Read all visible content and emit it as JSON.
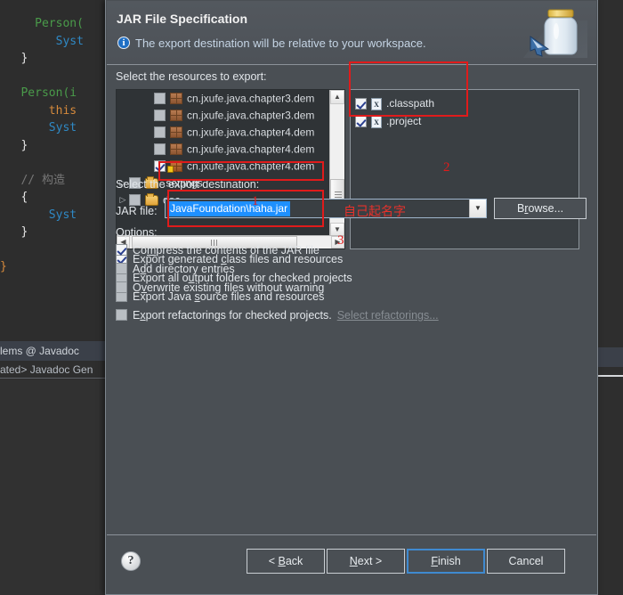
{
  "background": {
    "code_lines": [
      {
        "indent": 5,
        "segments": [
          {
            "t": "Person(",
            "c": "green"
          }
        ]
      },
      {
        "indent": 8,
        "segments": [
          {
            "t": "Syst",
            "c": "blue"
          }
        ]
      },
      {
        "indent": 3,
        "segments": [
          {
            "t": "}",
            "c": "white"
          }
        ]
      },
      {
        "indent": 0,
        "segments": []
      },
      {
        "indent": 3,
        "segments": [
          {
            "t": "Person(i",
            "c": "green"
          }
        ]
      },
      {
        "indent": 7,
        "segments": [
          {
            "t": "this",
            "c": "orange"
          }
        ]
      },
      {
        "indent": 7,
        "segments": [
          {
            "t": "Syst",
            "c": "blue"
          }
        ]
      },
      {
        "indent": 3,
        "segments": [
          {
            "t": "}",
            "c": "white"
          }
        ]
      },
      {
        "indent": 0,
        "segments": []
      },
      {
        "indent": 3,
        "segments": [
          {
            "t": "// 构造",
            "c": "gray"
          }
        ]
      },
      {
        "indent": 3,
        "segments": [
          {
            "t": "{",
            "c": "white"
          }
        ]
      },
      {
        "indent": 7,
        "segments": [
          {
            "t": "Syst",
            "c": "blue"
          }
        ]
      },
      {
        "indent": 3,
        "segments": [
          {
            "t": "}",
            "c": "white"
          }
        ]
      },
      {
        "indent": 0,
        "segments": []
      },
      {
        "indent": 0,
        "segments": [
          {
            "t": "}",
            "c": "orange"
          }
        ]
      }
    ],
    "tabs_text": "lems  @ Javadoc",
    "javadoc_status": "ated> Javadoc Gen"
  },
  "dialog": {
    "title": "JAR File Specification",
    "subtitle": "The export destination will be relative to your workspace.",
    "info_icon": "i",
    "jar_icon_name": "jar-file-icon"
  },
  "resources": {
    "label": "Select the resources to export:",
    "tree_items": [
      {
        "twisty": "",
        "checked": false,
        "icon": "package-icon",
        "label": "cn.jxufe.java.chapter3.dem"
      },
      {
        "twisty": "",
        "checked": false,
        "icon": "package-icon",
        "label": "cn.jxufe.java.chapter3.dem"
      },
      {
        "twisty": "",
        "checked": false,
        "icon": "package-icon",
        "label": "cn.jxufe.java.chapter4.dem"
      },
      {
        "twisty": "",
        "checked": false,
        "icon": "package-icon",
        "label": "cn.jxufe.java.chapter4.dem"
      },
      {
        "twisty": "",
        "checked": true,
        "icon": "package-locked-icon",
        "label": "cn.jxufe.java.chapter4.dem"
      },
      {
        "twisty": "▷",
        "checked": false,
        "icon": "folder-icon",
        "label": ".settings"
      },
      {
        "twisty": "▷",
        "checked": false,
        "icon": "folder-icon",
        "label": "doc"
      }
    ],
    "files": [
      {
        "checked": true,
        "icon": "xml-file-icon",
        "badge": "X",
        "label": ".classpath"
      },
      {
        "checked": true,
        "icon": "xml-file-icon",
        "badge": "X",
        "label": ".project"
      }
    ]
  },
  "export_options": [
    {
      "checked": true,
      "pre": "Export generated ",
      "mn": "c",
      "post": "lass files and resources"
    },
    {
      "checked": false,
      "pre": "Export all o",
      "mn": "u",
      "post": "tput folders for checked projects"
    },
    {
      "checked": false,
      "pre": "Export Java ",
      "mn": "s",
      "post": "ource files and resources"
    },
    {
      "checked": false,
      "pre": "E",
      "mn": "x",
      "post": "port refactorings for checked projects.",
      "link": "Select refactorings..."
    }
  ],
  "destination": {
    "label": "Select the export destination:",
    "jar_file_label": "JAR file:",
    "jar_file_value": "JavaFoundation\\haha.jar",
    "browse_label": "Browse...",
    "browse_mnemonic": "r"
  },
  "options": {
    "label": "Options:",
    "items": [
      {
        "checked": true,
        "pre": "Co",
        "mn": "m",
        "post": "press the contents of the JAR file"
      },
      {
        "checked": false,
        "pre": "A",
        "mn": "d",
        "post": "d directory entries"
      },
      {
        "checked": false,
        "pre": "O",
        "mn": "v",
        "post": "erwrite existing files without warning"
      }
    ]
  },
  "footer": {
    "help_label": "?",
    "buttons": [
      {
        "id": "back",
        "pre": "< ",
        "mn": "B",
        "post": "ack",
        "default": false
      },
      {
        "id": "next",
        "pre": "",
        "mn": "N",
        "post": "ext >",
        "default": false
      },
      {
        "id": "finish",
        "pre": "",
        "mn": "F",
        "post": "inish",
        "default": true
      },
      {
        "id": "cancel",
        "pre": "",
        "mn": "",
        "post": "Cancel",
        "default": false
      }
    ]
  },
  "annotations": {
    "num1": "1",
    "num2": "2",
    "num3": "3",
    "chinese_note": "自己起名字"
  },
  "colors": {
    "annotation_red": "#e01b1b",
    "dialog_bg": "#4a4f54",
    "selection_blue": "#1e90ff",
    "info_blue": "#1f6fc4"
  }
}
